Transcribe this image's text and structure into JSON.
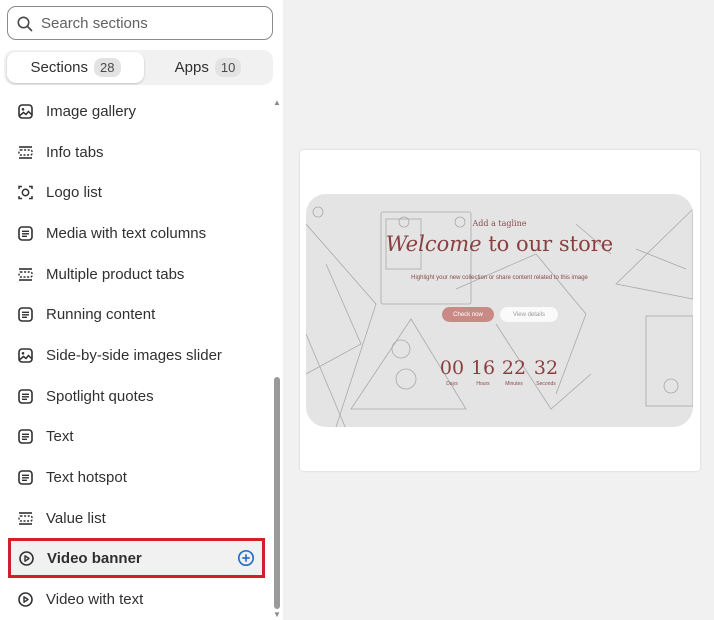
{
  "search": {
    "placeholder": "Search sections"
  },
  "tabs": [
    {
      "label": "Sections",
      "count": "28"
    },
    {
      "label": "Apps",
      "count": "10"
    }
  ],
  "sections": [
    {
      "label": "Image gallery",
      "icon": "image-icon"
    },
    {
      "label": "Info tabs",
      "icon": "tabs-icon"
    },
    {
      "label": "Logo list",
      "icon": "logo-icon"
    },
    {
      "label": "Media with text columns",
      "icon": "text-block-icon"
    },
    {
      "label": "Multiple product tabs",
      "icon": "tabs-icon"
    },
    {
      "label": "Running content",
      "icon": "text-block-icon"
    },
    {
      "label": "Side-by-side images slider",
      "icon": "image-icon"
    },
    {
      "label": "Spotlight quotes",
      "icon": "text-block-icon"
    },
    {
      "label": "Text",
      "icon": "text-block-icon"
    },
    {
      "label": "Text hotspot",
      "icon": "text-block-icon"
    },
    {
      "label": "Value list",
      "icon": "tabs-icon"
    },
    {
      "label": "Video banner",
      "icon": "play-icon",
      "selected": true
    },
    {
      "label": "Video with text",
      "icon": "play-icon"
    }
  ],
  "preview": {
    "tagline": "Add a tagline",
    "headline_italic": "Welcome",
    "headline_rest": " to our store",
    "subtext": "Highlight your new collection or share content related to this image",
    "primary_button": "Check now",
    "secondary_button": "View details",
    "countdown": [
      {
        "value": "00",
        "label": "Days"
      },
      {
        "value": "16",
        "label": "Hours"
      },
      {
        "value": "22",
        "label": "Minutes"
      },
      {
        "value": "32",
        "label": "Seconds"
      }
    ]
  },
  "colors": {
    "selection_outline": "#d21f2b",
    "add_icon": "#2c6ecb",
    "accent_text": "#8a3f3f",
    "primary_button": "#c98a86"
  }
}
